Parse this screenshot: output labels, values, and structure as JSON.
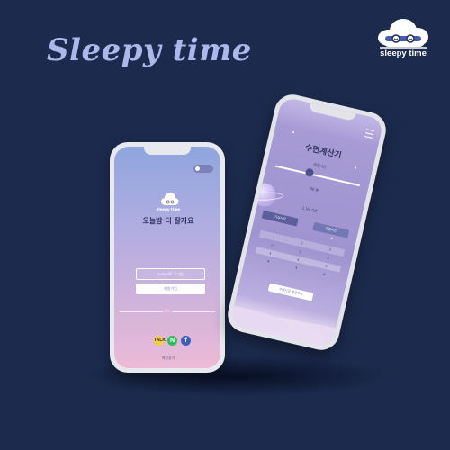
{
  "brand": {
    "title": "Sleepy time",
    "logo_text": "sleepy time"
  },
  "login_screen": {
    "toggle_label": "",
    "app_name": "sleepy time",
    "greeting": "오늘밤 더 잘자요",
    "email_login_button": "e-mail로 로그인",
    "join_button": "회원가입",
    "divider_text": "또는",
    "social": [
      {
        "name": "kakao",
        "glyph": "TALK",
        "color": "#f1d13c"
      },
      {
        "name": "naver",
        "glyph": "N",
        "color": "#2bbf5a"
      },
      {
        "name": "facebook",
        "glyph": "f",
        "color": "#3d5dbc"
      }
    ],
    "find_account": "계정찾기"
  },
  "calculator_screen": {
    "title": "수면계산기",
    "sleep_time_label": "취침시간",
    "slider_min": "",
    "slider_max": "",
    "slider_value": "00 분",
    "cycle_label": "1.5h 기준",
    "option_left": "기상시간",
    "option_right": "취침시간",
    "result_header": [
      "1",
      "2",
      "3"
    ],
    "result_rows": [
      [
        "2",
        "3",
        "4"
      ],
      [
        "3",
        "4",
        "5"
      ],
      [
        "4",
        "5",
        "6"
      ]
    ],
    "calculate_button": "수면시간 계산하기"
  }
}
